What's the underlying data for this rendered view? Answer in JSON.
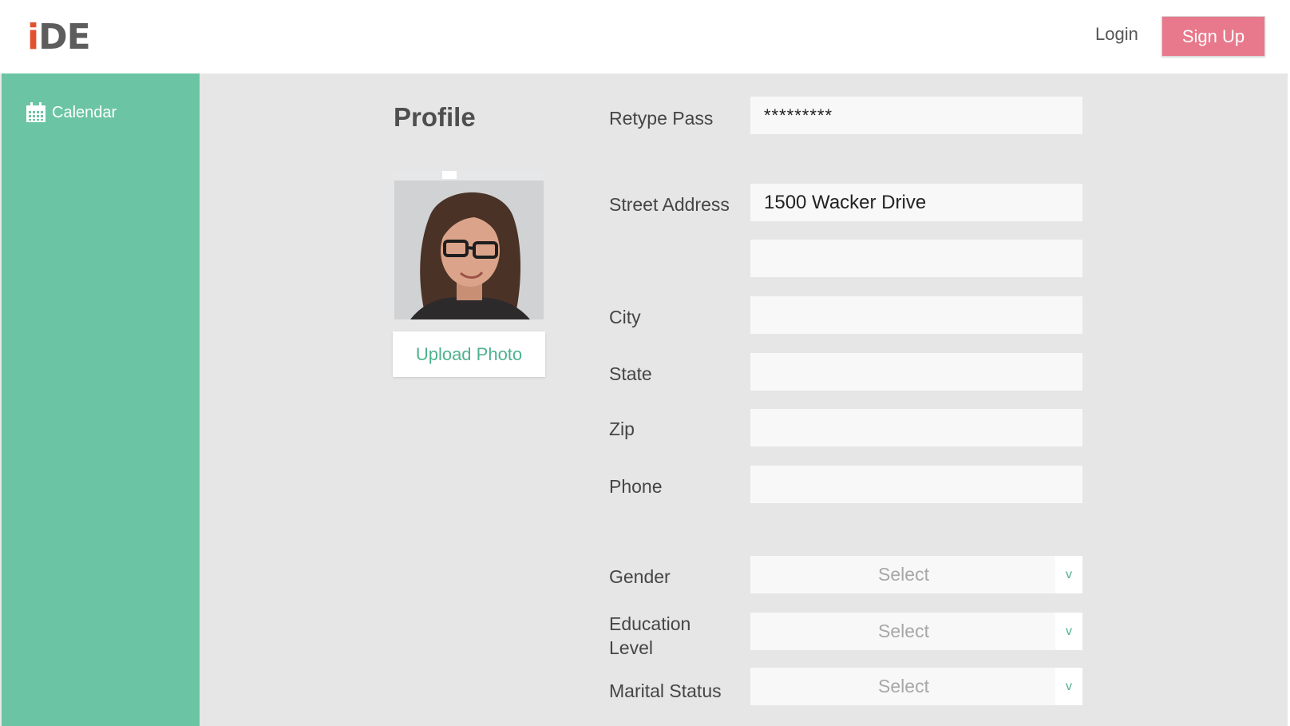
{
  "header": {
    "logo_i": "i",
    "logo_rest": "DE",
    "login_label": "Login",
    "signup_label": "Sign Up"
  },
  "sidebar": {
    "items": [
      {
        "label": "Calendar",
        "icon": "calendar-icon"
      }
    ]
  },
  "profile": {
    "title": "Profile",
    "upload_label": "Upload Photo"
  },
  "form": {
    "retype_pass": {
      "label": "Retype Pass",
      "value": "*********"
    },
    "street_address": {
      "label": "Street Address",
      "value": "1500 Wacker Drive",
      "value2": ""
    },
    "city": {
      "label": "City",
      "value": ""
    },
    "state": {
      "label": "State",
      "value": ""
    },
    "zip": {
      "label": "Zip",
      "value": ""
    },
    "phone": {
      "label": "Phone",
      "value": ""
    },
    "gender": {
      "label": "Gender",
      "value": "Select"
    },
    "education_level": {
      "label_line1": "Education",
      "label_line2": "Level",
      "value": "Select"
    },
    "marital_status": {
      "label": "Marital Status",
      "value": "Select"
    },
    "chevron_glyph": "v"
  },
  "colors": {
    "accent_green": "#6bc4a4",
    "signup_pink": "#e8798c",
    "logo_orange": "#e2512f",
    "link_green": "#4db28e"
  }
}
